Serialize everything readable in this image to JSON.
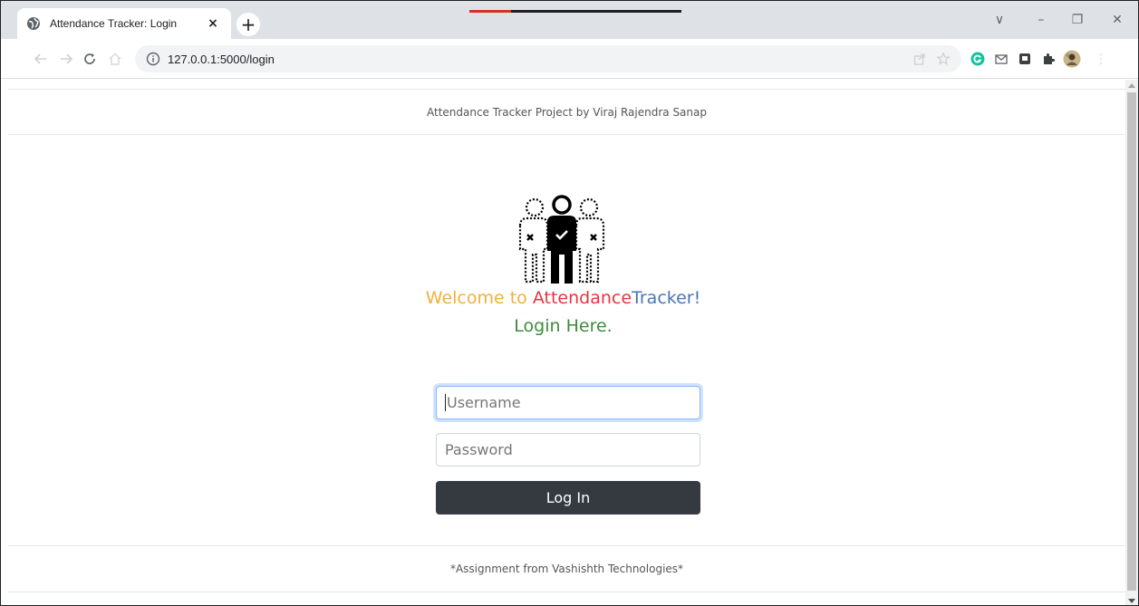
{
  "browser": {
    "tab_title": "Attendance Tracker: Login",
    "tab_close": "×",
    "new_tab": "+",
    "url": "127.0.0.1:5000/login",
    "window_controls": {
      "tab_search": "∨",
      "minimize": "–",
      "restore": "❐",
      "close": "✕"
    },
    "colors": {
      "tabstrip": "#dee1e6",
      "omnibox": "#f1f3f4",
      "grammarly": "#15c39a"
    }
  },
  "page": {
    "header_text": "Attendance Tracker Project by Viraj Rajendra Sanap",
    "welcome": {
      "part1": "Welcome to ",
      "part2": "Attendance",
      "part3": "Tracker!"
    },
    "login_here": "Login Here.",
    "form": {
      "username_placeholder": "Username",
      "password_placeholder": "Password",
      "submit_label": "Log In"
    },
    "footer_text": "*Assignment from Vashishth Technologies*",
    "colors": {
      "welcome_yellow": "#f0b03c",
      "welcome_red": "#e2373f",
      "welcome_blue": "#4a74b8",
      "login_green": "#3c8c3c",
      "button_dark": "#343a40"
    }
  }
}
